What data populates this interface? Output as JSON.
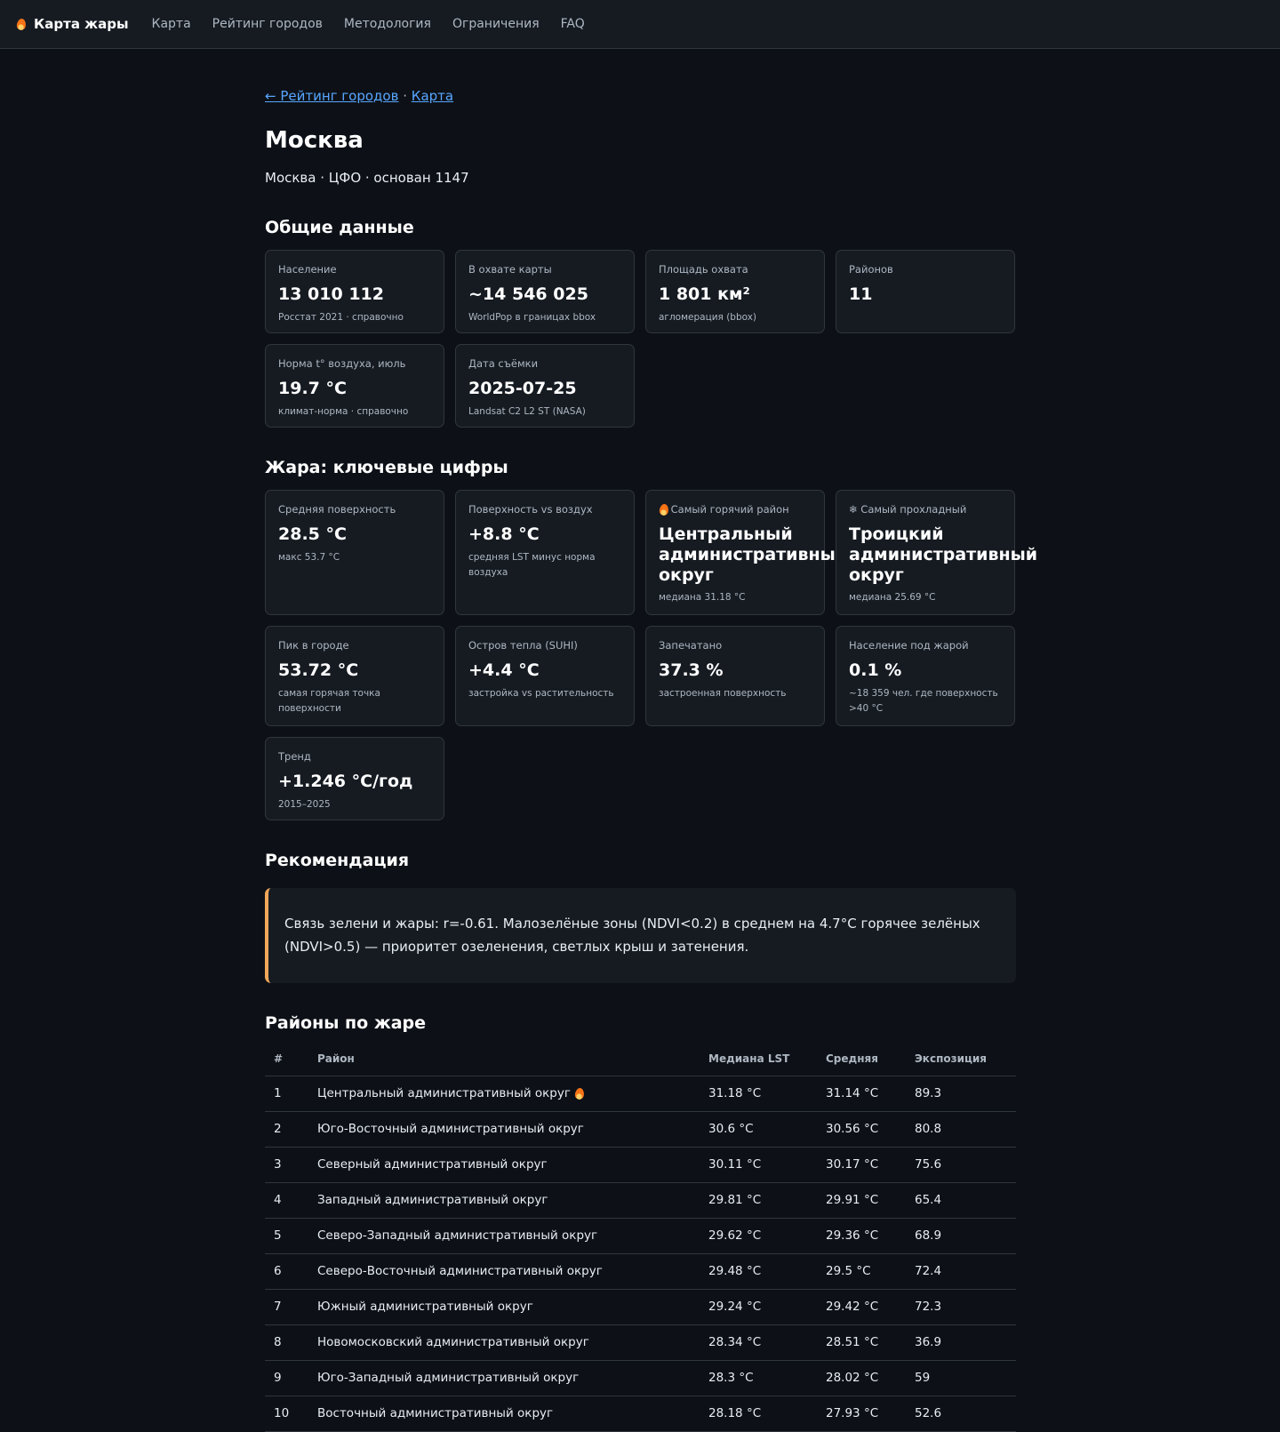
{
  "nav": {
    "brand": "Карта жары",
    "links": [
      "Карта",
      "Рейтинг городов",
      "Методология",
      "Ограничения",
      "FAQ"
    ]
  },
  "breadcrumb": {
    "back": "← Рейтинг городов",
    "sep": "·",
    "map": "Карта"
  },
  "city": {
    "title": "Москва",
    "subtitle": "Москва · ЦФО · основан 1147"
  },
  "general": {
    "heading": "Общие данные",
    "cards": [
      {
        "label": "Население",
        "value": "13 010 112",
        "note": "Росстат 2021 · справочно"
      },
      {
        "label": "В охвате карты",
        "value": "~14 546 025",
        "note": "WorldPop в границах bbox"
      },
      {
        "label": "Площадь охвата",
        "value": "1 801 км²",
        "note": "агломерация (bbox)"
      },
      {
        "label": "Районов",
        "value": "11",
        "note": ""
      },
      {
        "label": "Норма t° воздуха, июль",
        "value": "19.7 °C",
        "note": "климат-норма · справочно"
      },
      {
        "label": "Дата съёмки",
        "value": "2025-07-25",
        "note": "Landsat C2 L2 ST (NASA)"
      }
    ]
  },
  "heat": {
    "heading": "Жара: ключевые цифры",
    "cards": [
      {
        "label": "Средняя поверхность",
        "value": "28.5 °C",
        "note": "макс 53.7 °C"
      },
      {
        "label": "Поверхность vs воздух",
        "value": "+8.8 °C",
        "note": "средняя LST минус норма воздуха"
      },
      {
        "label": "Самый горячий район",
        "value": "Центральный административный округ",
        "note": "медиана 31.18 °C"
      },
      {
        "label": "Самый прохладный",
        "value": "Троицкий административный округ",
        "note": "медиана 25.69 °C"
      },
      {
        "label": "Пик в городе",
        "value": "53.72 °C",
        "note": "самая горячая точка поверхности"
      },
      {
        "label": "Остров тепла (SUHI)",
        "value": "+4.4 °C",
        "note": "застройка vs растительность"
      },
      {
        "label": "Запечатано",
        "value": "37.3 %",
        "note": "застроенная поверхность"
      },
      {
        "label": "Население под жарой",
        "value": "0.1 %",
        "note": "~18 359 чел. где поверхность >40 °C"
      },
      {
        "label": "Тренд",
        "value": "+1.246 °C/год",
        "note": "2015–2025"
      }
    ],
    "snow_glyph": "❄"
  },
  "recommendation": {
    "heading": "Рекомендация",
    "text": "Связь зелени и жары: r=-0.61. Малозелёные зоны (NDVI<0.2) в среднем на 4.7°C горячее зелёных (NDVI>0.5) — приоритет озеленения, светлых крыш и затенения."
  },
  "districts": {
    "heading": "Районы по жаре",
    "columns": [
      "#",
      "Район",
      "Медиана LST",
      "Средняя",
      "Экспозиция"
    ],
    "rows": [
      [
        "1",
        "Центральный административный округ",
        "31.18 °C",
        "31.14 °C",
        "89.3"
      ],
      [
        "2",
        "Юго-Восточный административный округ",
        "30.6 °C",
        "30.56 °C",
        "80.8"
      ],
      [
        "3",
        "Северный административный округ",
        "30.11 °C",
        "30.17 °C",
        "75.6"
      ],
      [
        "4",
        "Западный административный округ",
        "29.81 °C",
        "29.91 °C",
        "65.4"
      ],
      [
        "5",
        "Северо-Западный административный округ",
        "29.62 °C",
        "29.36 °C",
        "68.9"
      ],
      [
        "6",
        "Северо-Восточный административный округ",
        "29.48 °C",
        "29.5 °C",
        "72.4"
      ],
      [
        "7",
        "Южный административный округ",
        "29.24 °C",
        "29.42 °C",
        "72.3"
      ],
      [
        "8",
        "Новомосковский административный округ",
        "28.34 °C",
        "28.51 °C",
        "36.9"
      ],
      [
        "9",
        "Юго-Западный административный округ",
        "28.3 °C",
        "28.02 °C",
        "59"
      ],
      [
        "10",
        "Восточный административный округ",
        "28.18 °C",
        "27.93 °C",
        "52.6"
      ]
    ]
  },
  "colors": {
    "background": "#0d1117",
    "card": "#161b22",
    "border": "#30363d",
    "link": "#58a6ff",
    "accent": "#f0a75a",
    "flame": "#f97316"
  }
}
